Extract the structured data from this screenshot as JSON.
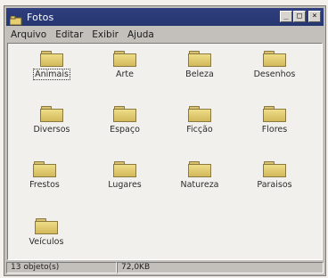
{
  "window": {
    "title": "Fotos"
  },
  "controls": {
    "minimize": "_",
    "maximize": "□",
    "close": "×"
  },
  "menu": [
    "Arquivo",
    "Editar",
    "Exibir",
    "Ajuda"
  ],
  "folders": [
    "Animais",
    "Arte",
    "Beleza",
    "Desenhos",
    "Diversos",
    "Espaço",
    "Ficção",
    "Flores",
    "Frestos",
    "Lugares",
    "Natureza",
    "Paraisos",
    "Veículos"
  ],
  "status": {
    "count": "13 objeto(s)",
    "size": "72,0KB"
  }
}
